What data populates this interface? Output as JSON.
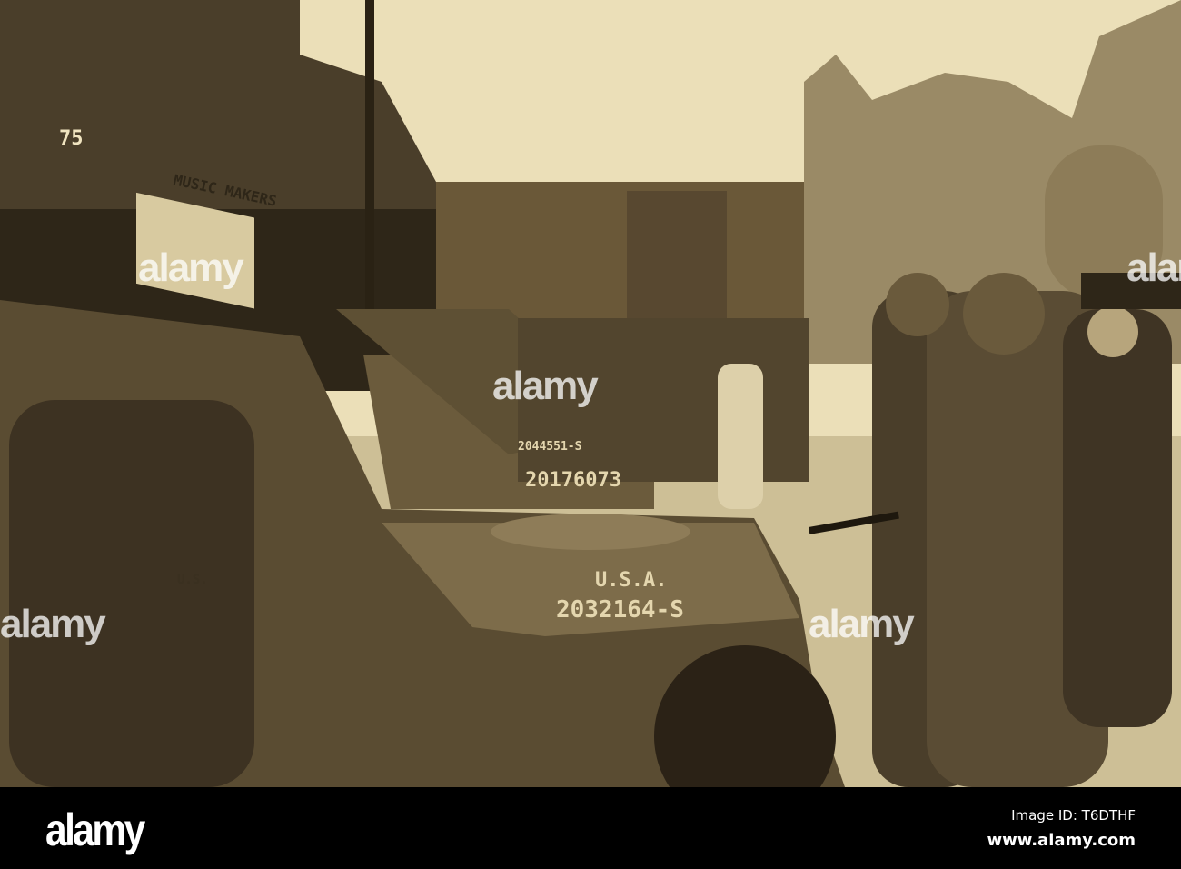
{
  "photo": {
    "description_tone": "sepia",
    "colors": {
      "sky": "#ebdfb8",
      "dark": "#3a3020",
      "mid": "#7a6a48",
      "road": "#c9bb92"
    },
    "shop_signs": {
      "number": "75",
      "music_makers": "MUSIC MAKERS"
    },
    "jeep_markings": {
      "usa": "U.S.A.",
      "serial_front": "2032164-S",
      "serial_second": "20176073",
      "serial_third": "2044551-S",
      "pouch": "U.S."
    },
    "watermarks": [
      "alamy",
      "alamy",
      "alamy",
      "alamy",
      "alamy"
    ]
  },
  "footer": {
    "logo": "alamy",
    "image_id": "Image ID: T6DTHF",
    "url": "www.alamy.com"
  }
}
